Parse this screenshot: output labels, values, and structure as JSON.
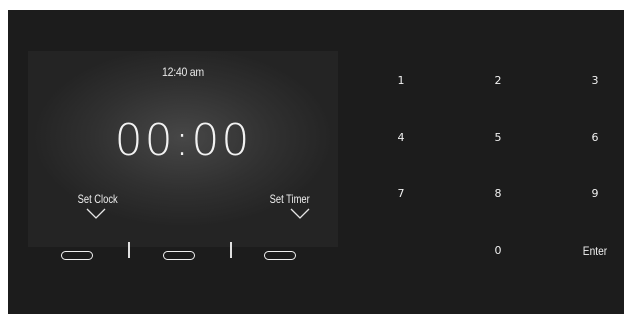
{
  "display": {
    "current_time": "12:40 am",
    "timer_value": "00:00"
  },
  "soft_buttons": {
    "set_clock_label": "Set Clock",
    "set_timer_label": "Set Timer"
  },
  "keypad": {
    "keys": [
      "1",
      "2",
      "3",
      "4",
      "5",
      "6",
      "7",
      "8",
      "9",
      "0",
      "Enter"
    ]
  },
  "colors": {
    "background": "#1c1c1c",
    "screen": "#303030",
    "text": "#f0f0f0"
  }
}
